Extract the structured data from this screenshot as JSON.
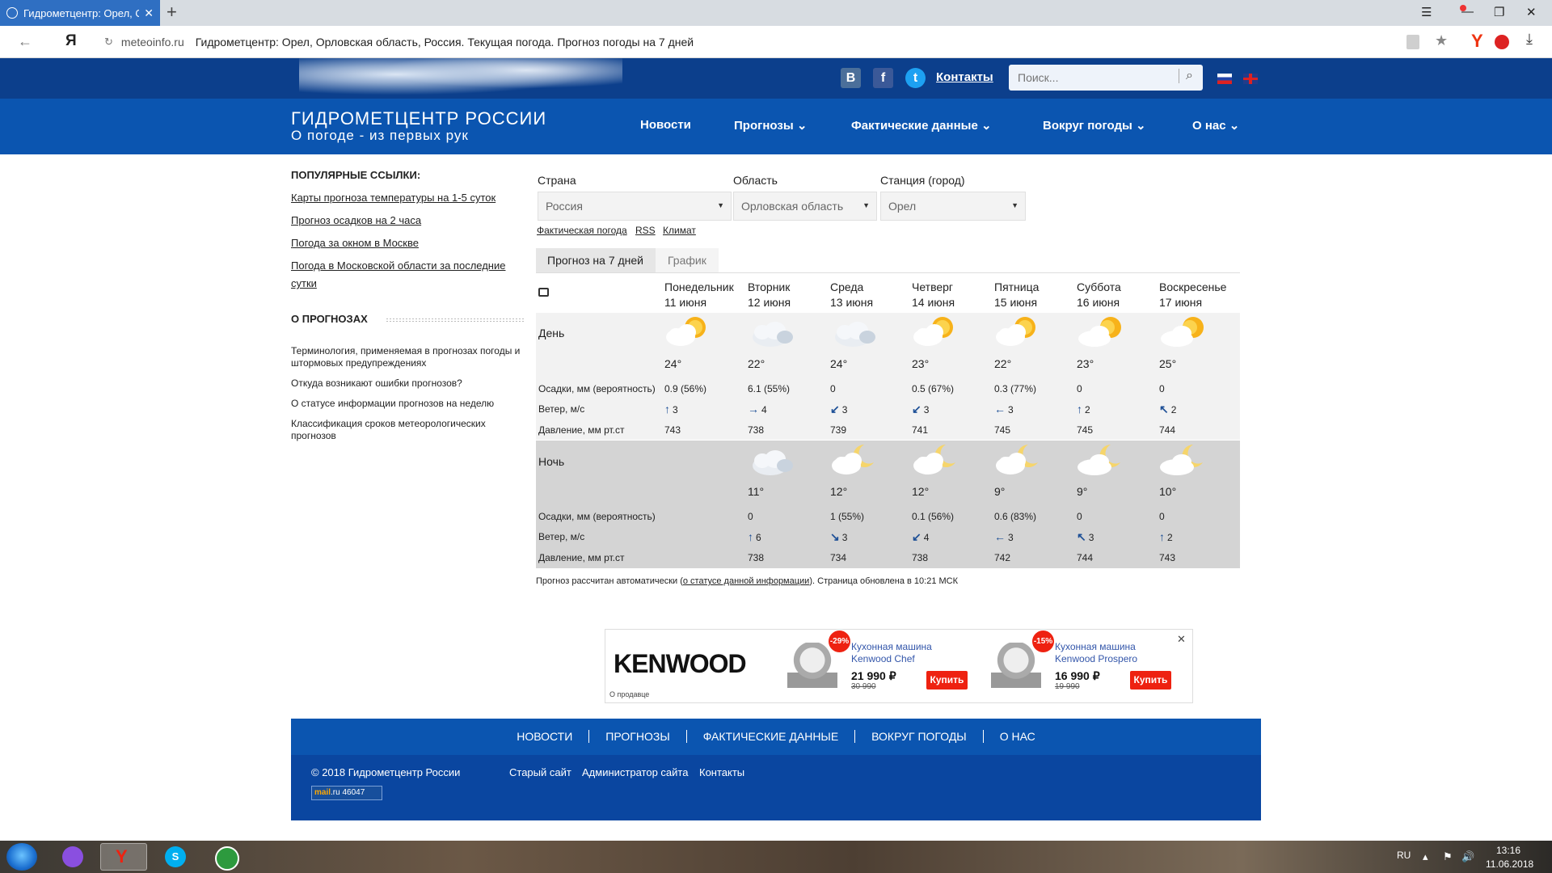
{
  "browser": {
    "tab_title": "Гидрометцентр: Орел, О",
    "domain": "meteoinfo.ru",
    "page_title": "Гидрометцентр: Орел, Орловская область, Россия. Текущая погода. Прогноз погоды на 7 дней",
    "yandex_letter": "Я"
  },
  "header": {
    "contacts": "Контакты",
    "search_placeholder": "Поиск...",
    "brand_title": "ГИДРОМЕТЦЕНТР РОССИИ",
    "brand_slogan": "О погоде - из первых рук",
    "social": {
      "vk": "B",
      "fb": "f",
      "tw": "t"
    },
    "nav": [
      "Новости",
      "Прогнозы",
      "Фактические данные",
      "Вокруг погоды",
      "О нас"
    ]
  },
  "left": {
    "popular_title": "ПОПУЛЯРНЫЕ ССЫЛКИ:",
    "popular_links": [
      "Карты прогноза температуры на 1-5 суток",
      "Прогноз осадков на 2 часа",
      "Погода за окном в Москве",
      "Погода в Московской области за последние сутки"
    ],
    "about_title": "О ПРОГНОЗАХ",
    "about_links": [
      "Терминология, применяемая в прогнозах погоды и штормовых предупреждениях",
      "Откуда возникают ошибки прогнозов?",
      "О статусе информации прогнозов на неделю",
      "Классификация сроков метеорологических прогнозов"
    ]
  },
  "selectors": {
    "country_label": "Страна",
    "country_value": "Россия",
    "region_label": "Область",
    "region_value": "Орловская область",
    "station_label": "Станция (город)",
    "station_value": "Орел",
    "sub_links": [
      "Фактическая погода",
      "RSS",
      "Климат"
    ]
  },
  "tabs": {
    "active": "Прогноз на 7 дней",
    "inactive": "График"
  },
  "forecast": {
    "day_label": "День",
    "night_label": "Ночь",
    "precip_label": "Осадки, мм (вероятность)",
    "wind_label": "Ветер, м/с",
    "pressure_label": "Давление, мм рт.ст",
    "days": [
      {
        "name": "Понедельник",
        "date": "11 июня"
      },
      {
        "name": "Вторник",
        "date": "12 июня"
      },
      {
        "name": "Среда",
        "date": "13 июня"
      },
      {
        "name": "Четверг",
        "date": "14 июня"
      },
      {
        "name": "Пятница",
        "date": "15 июня"
      },
      {
        "name": "Суббота",
        "date": "16 июня"
      },
      {
        "name": "Воскресенье",
        "date": "17 июня"
      }
    ],
    "day_rows": {
      "icons": [
        "partly-cloudy-sun-icon",
        "cloudy-icon",
        "cloudy-icon",
        "partly-cloudy-sun-icon",
        "partly-cloudy-sun-icon",
        "sun-cloud-icon",
        "sun-cloud-icon"
      ],
      "temps": [
        "24°",
        "22°",
        "24°",
        "23°",
        "22°",
        "23°",
        "25°"
      ],
      "precip": [
        "0.9 (56%)",
        "6.1 (55%)",
        "0",
        "0.5 (67%)",
        "0.3 (77%)",
        "0",
        "0"
      ],
      "wind_arrows": [
        "↑",
        "→",
        "↙",
        "↙",
        "←",
        "↑",
        "↖"
      ],
      "wind": [
        "3",
        "4",
        "3",
        "3",
        "3",
        "2",
        "2"
      ],
      "pressure": [
        "743",
        "738",
        "739",
        "741",
        "745",
        "745",
        "744"
      ]
    },
    "night_rows": {
      "icons": [
        "cloudy-icon",
        "partly-cloudy-moon-icon",
        "partly-cloudy-moon-icon",
        "partly-cloudy-moon-icon",
        "moon-cloud-icon",
        "moon-cloud-icon"
      ],
      "temps": [
        "11°",
        "12°",
        "12°",
        "9°",
        "9°",
        "10°"
      ],
      "precip": [
        "0",
        "1 (55%)",
        "0.1 (56%)",
        "0.6 (83%)",
        "0",
        "0"
      ],
      "wind_arrows": [
        "↑",
        "↘",
        "↙",
        "←",
        "↖",
        "↑"
      ],
      "wind": [
        "6",
        "3",
        "4",
        "3",
        "3",
        "2"
      ],
      "pressure": [
        "738",
        "734",
        "738",
        "742",
        "744",
        "743"
      ]
    },
    "footnote_pre": "Прогноз рассчитан автоматически (",
    "footnote_link": "о статусе данной информации",
    "footnote_post": "). Страница обновлена в 10:21 МСК"
  },
  "ad": {
    "brand": "KENWOOD",
    "sale_note": "О продавце",
    "products": [
      {
        "discount": "-29%",
        "name1": "Кухонная машина",
        "name2": "Kenwood Chef",
        "price": "21 990 ₽",
        "old": "30 990",
        "buy": "Купить"
      },
      {
        "discount": "-15%",
        "name1": "Кухонная машина",
        "name2": "Kenwood Prospero",
        "price": "16 990 ₽",
        "old": "19 990",
        "buy": "Купить"
      }
    ]
  },
  "footer": {
    "nav": [
      "НОВОСТИ",
      "ПРОГНОЗЫ",
      "ФАКТИЧЕСКИЕ ДАННЫЕ",
      "ВОКРУГ ПОГОДЫ",
      "О НАС"
    ],
    "copyright": "© 2018 Гидрометцентр России",
    "links": [
      "Старый сайт",
      "Администратор сайта",
      "Контакты"
    ],
    "counter_brand": "mail",
    "counter_suffix": ".ru",
    "counter_value": "46047"
  },
  "taskbar": {
    "lang": "RU",
    "time": "13:16",
    "date": "11.06.2018"
  }
}
